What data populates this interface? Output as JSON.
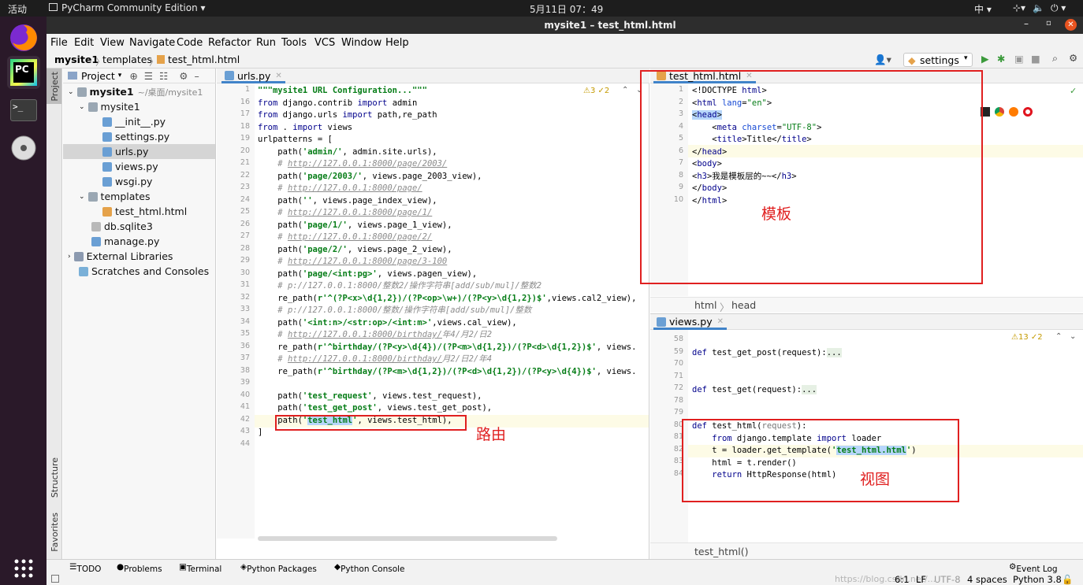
{
  "topbar": {
    "activities": "活动",
    "app_name": "PyCharm Community Edition ▾",
    "clock": "5月11日 07：49",
    "ime": "中 ▾"
  },
  "window": {
    "title": "mysite1 – test_html.html"
  },
  "menu": [
    "File",
    "Edit",
    "View",
    "Navigate",
    "Code",
    "Refactor",
    "Run",
    "Tools",
    "VCS",
    "Window",
    "Help"
  ],
  "breadcrumb": {
    "project": "mysite1",
    "folder": "templates",
    "file": "test_html.html"
  },
  "run_config": "settings",
  "tool_strip": {
    "project": "Project",
    "structure": "Structure",
    "favorites": "Favorites"
  },
  "project_panel": {
    "title": "Project",
    "items": [
      {
        "label": "mysite1",
        "suffix": "~/桌面/mysite1"
      },
      {
        "label": "mysite1"
      },
      {
        "label": "__init__.py"
      },
      {
        "label": "settings.py"
      },
      {
        "label": "urls.py"
      },
      {
        "label": "views.py"
      },
      {
        "label": "wsgi.py"
      },
      {
        "label": "templates"
      },
      {
        "label": "test_html.html"
      },
      {
        "label": "db.sqlite3"
      },
      {
        "label": "manage.py"
      },
      {
        "label": "External Libraries"
      },
      {
        "label": "Scratches and Consoles"
      }
    ]
  },
  "urls_editor": {
    "tab": "urls.py",
    "inspection": "⚠3 ✓2",
    "line_numbers": [
      "1",
      "16",
      "17",
      "18",
      "19",
      "20",
      "21",
      "22",
      "23",
      "24",
      "25",
      "26",
      "27",
      "28",
      "29",
      "30",
      "31",
      "32",
      "33",
      "34",
      "35",
      "36",
      "37",
      "38",
      "39",
      "40",
      "41",
      "42",
      "43",
      "44"
    ]
  },
  "html_editor": {
    "tab": "test_html.html",
    "line_numbers": [
      "1",
      "2",
      "3",
      "4",
      "5",
      "6",
      "7",
      "8",
      "9",
      "10"
    ],
    "crumb1": "html",
    "crumb2": "head"
  },
  "views_editor": {
    "tab": "views.py",
    "inspection": "⚠13 ✓2",
    "line_numbers": [
      "58",
      "59",
      "70",
      "71",
      "72",
      "78",
      "79",
      "80",
      "81",
      "82",
      "83",
      "84"
    ],
    "footer": "test_html()"
  },
  "annotations": {
    "template": "模板",
    "route": "路由",
    "view": "视图"
  },
  "bottom_tools": [
    "TODO",
    "Problems",
    "Terminal",
    "Python Packages",
    "Python Console",
    "Event Log"
  ],
  "status": {
    "position": "6:1",
    "line_sep": "LF",
    "encoding": "UTF-8",
    "indent": "4 spaces",
    "interpreter": "Python 3.8"
  },
  "watermark": "https://blog.csdn.net/..."
}
